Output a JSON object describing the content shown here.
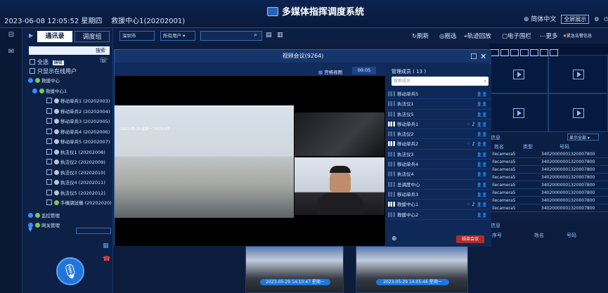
{
  "header": {
    "datetime": "2023-06-08 12:05:52 星期四",
    "center_name": "救援中心1(20202001)",
    "system_title": "多媒体指挥调度系统",
    "language": "简体中文",
    "fullscreen": "全屏展示"
  },
  "left_panel": {
    "tabs": [
      "通讯录",
      "调度组"
    ],
    "search_button": "搜索",
    "select_all": "全选",
    "select_all_badge": "编辑",
    "online_only": "只显示在线用户",
    "tree": [
      {
        "label": "救援中心",
        "level": 0,
        "type": "group"
      },
      {
        "label": "救援中心1",
        "level": 1,
        "type": "group"
      },
      {
        "label": "移动单兵1 (20202003)",
        "level": 2,
        "type": "person"
      },
      {
        "label": "移动单兵2 (20202004)",
        "level": 2,
        "type": "person"
      },
      {
        "label": "移动单兵3 (20202005)",
        "level": 2,
        "type": "person"
      },
      {
        "label": "移动单兵4 (20202006)",
        "level": 2,
        "type": "person"
      },
      {
        "label": "移动单兵5 (20202007)",
        "level": 2,
        "type": "person"
      },
      {
        "label": "执法仪1 (20202008)",
        "level": 2,
        "type": "person"
      },
      {
        "label": "执法仪2 (20202009)",
        "level": 2,
        "type": "person"
      },
      {
        "label": "执法仪3 (20202010)",
        "level": 2,
        "type": "person"
      },
      {
        "label": "执法仪4 (20202011)",
        "level": 2,
        "type": "person"
      },
      {
        "label": "执法仪5 (20202012)",
        "level": 2,
        "type": "person"
      },
      {
        "label": "手機調試機 (20202020)",
        "level": 2,
        "type": "device"
      },
      {
        "label": "监控管理",
        "level": 0,
        "type": "group"
      },
      {
        "label": "网关管理",
        "level": 0,
        "type": "group"
      }
    ]
  },
  "toolbar": {
    "city_select": "深圳市",
    "user_select": "所有用户",
    "buttons": [
      "刷新",
      "圈选",
      "轨迹回放",
      "电子围栏",
      "更多",
      "紧急告警信息"
    ]
  },
  "modal": {
    "title": "视频会议(9264)",
    "view_mode": "宫格视图",
    "timer": "00:05",
    "members_header": "管理成员 ( 13 )",
    "member_search_placeholder": "搜索成员",
    "members": [
      {
        "name": "移动单兵5",
        "signal": false,
        "video": false
      },
      {
        "name": "执法仪1",
        "signal": false,
        "video": false
      },
      {
        "name": "执法仪5",
        "signal": false,
        "video": false
      },
      {
        "name": "移动单兵1",
        "signal": true,
        "video": true
      },
      {
        "name": "执法仪2",
        "signal": false,
        "video": false
      },
      {
        "name": "移动单兵2",
        "signal": true,
        "video": true
      },
      {
        "name": "执法仪3",
        "signal": false,
        "video": false
      },
      {
        "name": "移动单兵4",
        "signal": false,
        "video": false
      },
      {
        "name": "执法仪4",
        "signal": false,
        "video": false
      },
      {
        "name": "总调度中心",
        "signal": false,
        "video": false
      },
      {
        "name": "移动单兵3",
        "signal": false,
        "video": false
      },
      {
        "name": "救援中心1",
        "signal": true,
        "video": true
      },
      {
        "name": "救援中心2",
        "signal": false,
        "video": false
      }
    ],
    "end_button": "结束会议"
  },
  "right_panel": {
    "info_title": "信息",
    "filter": "显示全部",
    "columns": [
      "姓名",
      "类型",
      "号码"
    ],
    "rows": [
      {
        "name": "ilecamera5",
        "number": "34020000001320007800"
      },
      {
        "name": "ilecamera5",
        "number": "34020000001320007800"
      },
      {
        "name": "ilecamera5",
        "number": "34020000001320007800"
      },
      {
        "name": "ilecamera5",
        "number": "34020000001320007800"
      },
      {
        "name": "ilecamera5",
        "number": "34020000001320007800"
      },
      {
        "name": "ilecamera5",
        "number": "34020000001320007800"
      },
      {
        "name": "ilecamera5",
        "number": "34020000001320007800"
      },
      {
        "name": "ilecamera5",
        "number": "34020000001320007800"
      }
    ],
    "lower_title": "信息",
    "lower_columns": [
      "序号",
      "姓名",
      "号码"
    ]
  },
  "thumbnails": [
    {
      "caption": "2023-05-29 14:10:47 星期一"
    },
    {
      "caption": "2023-05-29 14:05:46 星期一"
    }
  ],
  "video_overlay": "2023-05-29 星期一 14:10:47"
}
